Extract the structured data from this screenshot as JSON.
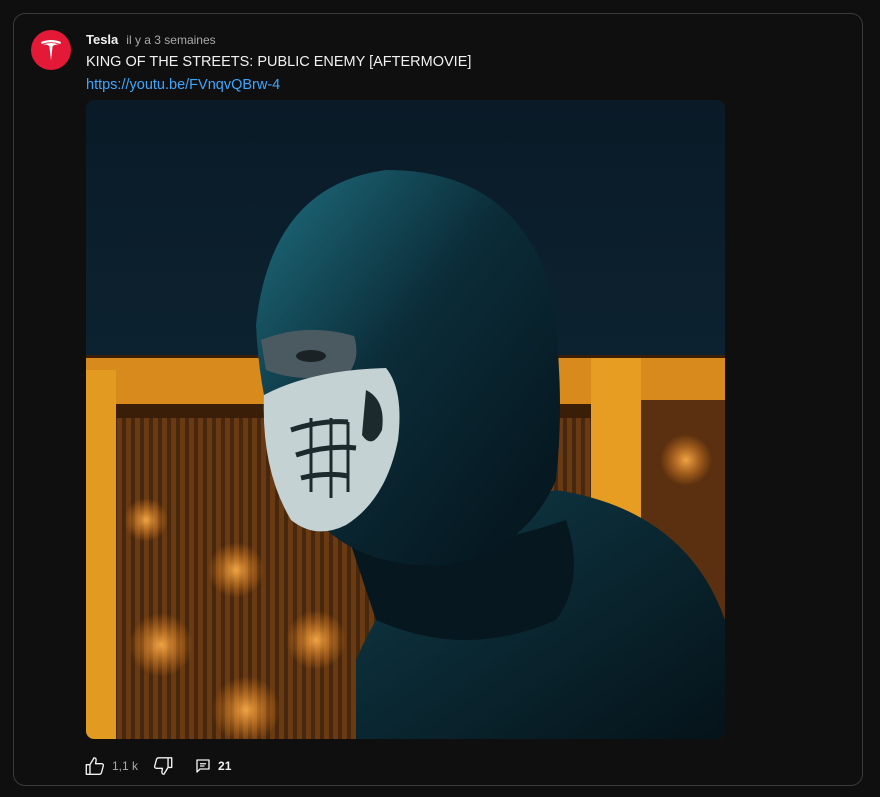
{
  "post": {
    "channel_name": "Tesla",
    "published": "il y a 3 semaines",
    "title": "KING OF THE STREETS: PUBLIC ENEMY [AFTERMOVIE]",
    "link": "https://youtu.be/FVnqvQBrw-4"
  },
  "actions": {
    "like_count": "1,1 k",
    "comment_count": "21"
  },
  "colors": {
    "background": "#0f0f0f",
    "brand_red": "#e31937",
    "link_blue": "#3ea6ff",
    "muted_text": "#aaaaaa"
  },
  "icons": {
    "avatar": "tesla-logo-icon",
    "like": "thumbs-up-icon",
    "dislike": "thumbs-down-icon",
    "comments": "comment-icon"
  }
}
